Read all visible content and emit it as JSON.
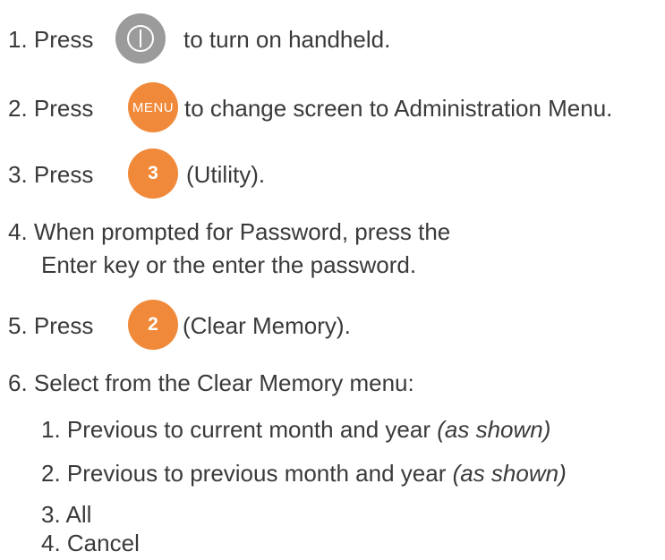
{
  "steps": [
    {
      "number": "1.",
      "prefix": "Press",
      "suffix": "to turn on handheld.",
      "icon": "power-icon"
    },
    {
      "number": "2.",
      "prefix": "Press",
      "button_label": "MENU",
      "suffix": "to change screen to Administration Menu."
    },
    {
      "number": "3.",
      "prefix": "Press",
      "button_label": "3",
      "suffix": "(Utility)."
    },
    {
      "number": "4.",
      "line1": "When prompted for Password, press the",
      "line2": "Enter key or the enter the password."
    },
    {
      "number": "5.",
      "prefix": "Press",
      "button_label": "2",
      "suffix": "(Clear Memory)."
    },
    {
      "number": "6.",
      "text": "Select from the Clear Memory menu:"
    }
  ],
  "menu_options": [
    {
      "text": "1. Previous to current month and year",
      "note": "(as shown)"
    },
    {
      "text": "2. Previous to previous month and year",
      "note": "(as shown)"
    },
    {
      "text": "3. All"
    },
    {
      "text": "4. Cancel"
    }
  ],
  "colors": {
    "text": "#3a3a3a",
    "gray_button": "#9b9b9b",
    "orange_button": "#f08a3a"
  }
}
